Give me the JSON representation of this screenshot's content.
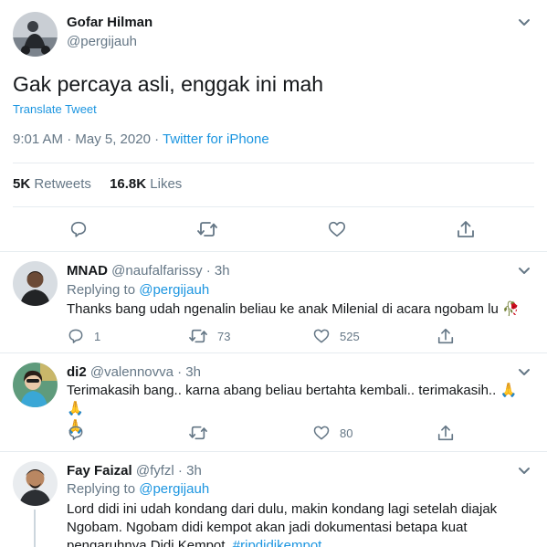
{
  "main": {
    "name": "Gofar Hilman",
    "handle": "@pergijauh",
    "text": "Gak percaya asli, enggak ini mah",
    "translate": "Translate Tweet",
    "time": "9:01 AM · May 5, 2020 · ",
    "source": "Twitter for iPhone",
    "retweets_count": "5K",
    "retweets_label": "Retweets",
    "likes_count": "16.8K",
    "likes_label": "Likes"
  },
  "replies": [
    {
      "name": "MNAD",
      "handle": "@naufalfarissy · 3h",
      "replying_label": "Replying to ",
      "replying_to": "@pergijauh",
      "text": "Thanks bang udah ngenalin beliau ke anak Milenial di acara ngobam lu ",
      "emoji": "🥀",
      "reply_count": "1",
      "retweet_count": "73",
      "like_count": "525"
    },
    {
      "name": "di2",
      "handle": "@valennovva · 3h",
      "text": "Terimakasih bang.. karna abang beliau bertahta kembali.. terimakasih.. ",
      "emoji_inline": "🙏🙏",
      "emoji_next": "🙏",
      "reply_count": "",
      "retweet_count": "",
      "like_count": "80"
    },
    {
      "name": "Fay Faizal",
      "handle": "@fyfzl · 3h",
      "replying_label": "Replying to ",
      "replying_to": "@pergijauh",
      "text_line1": "Lord didi ini udah kondang dari dulu, makin kondang lagi setelah diajak",
      "text_line2": "Ngobam. Ngobam didi kempot akan jadi dokumentasi betapa kuat",
      "text_line3": "pengaruhnya Didi Kempot. ",
      "hashtag": "#ripdidikempot"
    }
  ],
  "icons": {
    "reply": "reply-icon",
    "retweet": "retweet-icon",
    "like": "heart-icon",
    "share": "share-icon",
    "caret": "chevron-down-icon"
  },
  "colors": {
    "link": "#1b95e0",
    "muted": "#657786",
    "divider": "#e6ecf0"
  }
}
